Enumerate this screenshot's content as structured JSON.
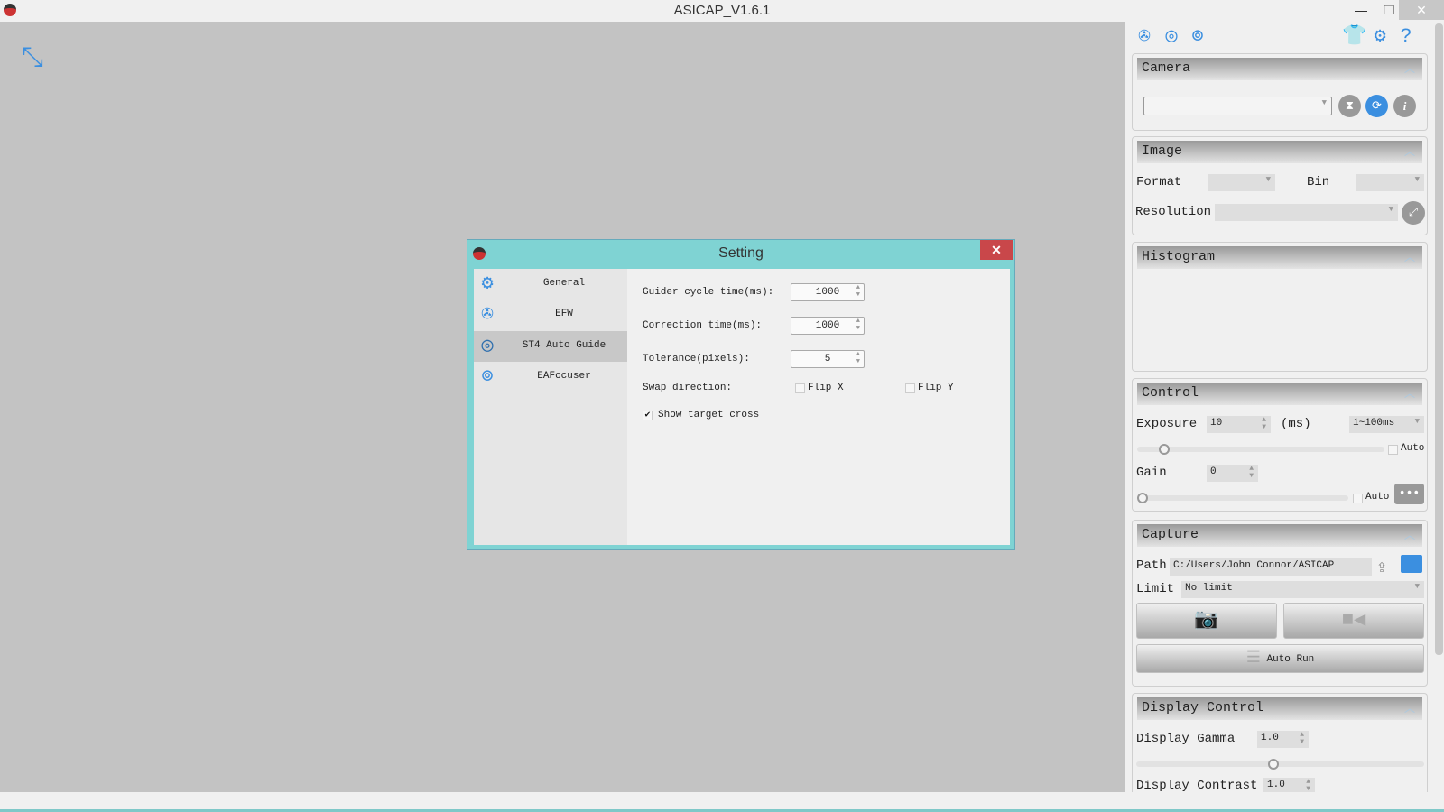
{
  "window": {
    "title": "ASICAP_V1.6.1",
    "minimize": "—",
    "maximize": "❐",
    "close": "✕"
  },
  "accent": "#3b8fe0",
  "toolbar": {
    "icons": [
      "filter-wheel-icon",
      "telescope-icon",
      "focuser-icon",
      "shirt-icon",
      "gear-icon",
      "help-icon"
    ]
  },
  "camera": {
    "header": "Camera",
    "selected": ""
  },
  "image": {
    "header": "Image",
    "format_label": "Format",
    "format_value": "",
    "bin_label": "Bin",
    "bin_value": "",
    "resolution_label": "Resolution",
    "resolution_value": ""
  },
  "histogram": {
    "header": "Histogram"
  },
  "control": {
    "header": "Control",
    "exposure_label": "Exposure",
    "exposure_value": "10",
    "exposure_unit": "(ms)",
    "exposure_range": "1~100ms",
    "auto_label": "Auto",
    "gain_label": "Gain",
    "gain_value": "0",
    "gain_auto_label": "Auto",
    "more": "•••"
  },
  "capture": {
    "header": "Capture",
    "path_label": "Path",
    "path_value": "C:/Users/John Connor/ASICAP",
    "limit_label": "Limit",
    "limit_value": "No limit",
    "autorun_label": "Auto Run"
  },
  "display_control": {
    "header": "Display Control",
    "gamma_label": "Display Gamma",
    "gamma_value": "1.0",
    "contrast_label": "Display Contrast",
    "contrast_value": "1.0"
  },
  "dialog": {
    "title": "Setting",
    "close": "✕",
    "nav": [
      {
        "label": "General",
        "icon": "gear-icon"
      },
      {
        "label": "EFW",
        "icon": "filter-wheel-icon"
      },
      {
        "label": "ST4 Auto Guide",
        "icon": "telescope-icon",
        "selected": true
      },
      {
        "label": "EAFocuser",
        "icon": "focuser-icon"
      }
    ],
    "fields": {
      "guider_cycle_label": "Guider cycle time(ms):",
      "guider_cycle_value": "1000",
      "correction_label": "Correction time(ms):",
      "correction_value": "1000",
      "tolerance_label": "Tolerance(pixels):",
      "tolerance_value": "5",
      "swap_label": "Swap direction:",
      "flip_x": "Flip X",
      "flip_y": "Flip Y",
      "show_cross": "Show target cross"
    },
    "state": {
      "flip_x": false,
      "flip_y": false,
      "show_cross": true
    }
  }
}
